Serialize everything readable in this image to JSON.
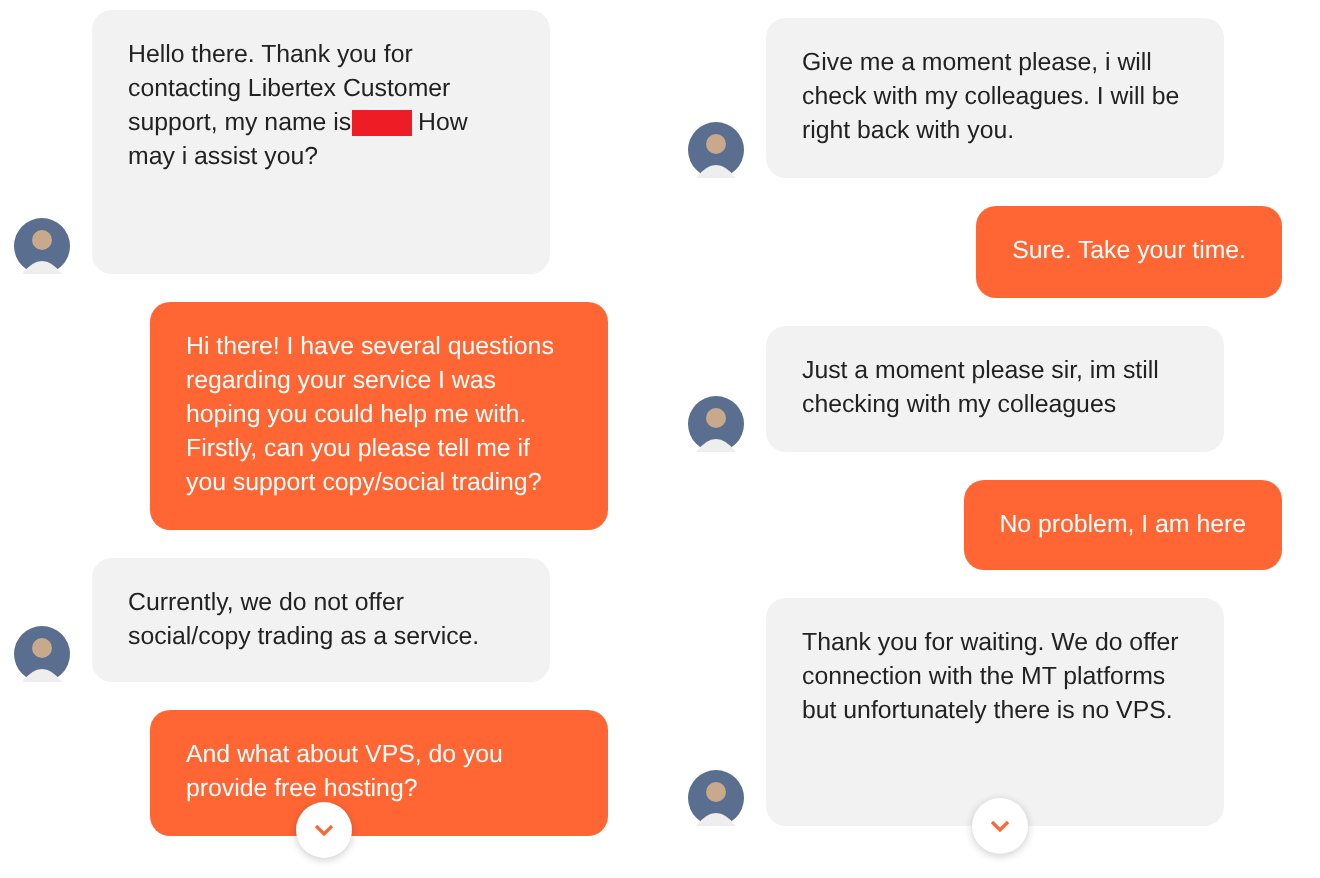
{
  "columns": [
    {
      "messages": [
        {
          "kind": "agent",
          "text": "Hello there. Thank you for contacting Libertex Customer support, my name is",
          "redacted": true,
          "text_after": "How may i assist you?"
        },
        {
          "kind": "user",
          "text": "Hi there! I have several questions regarding your service I was hoping you could help me with. Firstly, can you please tell me if you support copy/social trading?"
        },
        {
          "kind": "agent",
          "text": "Currently, we do not offer social/copy trading as a service."
        },
        {
          "kind": "user",
          "text": "And what about VPS, do you provide free hosting?"
        }
      ],
      "scroll_down_button": true
    },
    {
      "messages": [
        {
          "kind": "agent",
          "text": "Give me a moment please, i will check with my colleagues. I will be right back with you."
        },
        {
          "kind": "user",
          "text": "Sure. Take your time."
        },
        {
          "kind": "agent",
          "text": "Just a moment please sir, im still checking with my colleagues"
        },
        {
          "kind": "user",
          "text": "No problem, I am here"
        },
        {
          "kind": "agent",
          "text": "Thank you for waiting. We do offer connection with the MT platforms but unfortunately there is no VPS."
        }
      ],
      "scroll_down_button": true
    }
  ]
}
